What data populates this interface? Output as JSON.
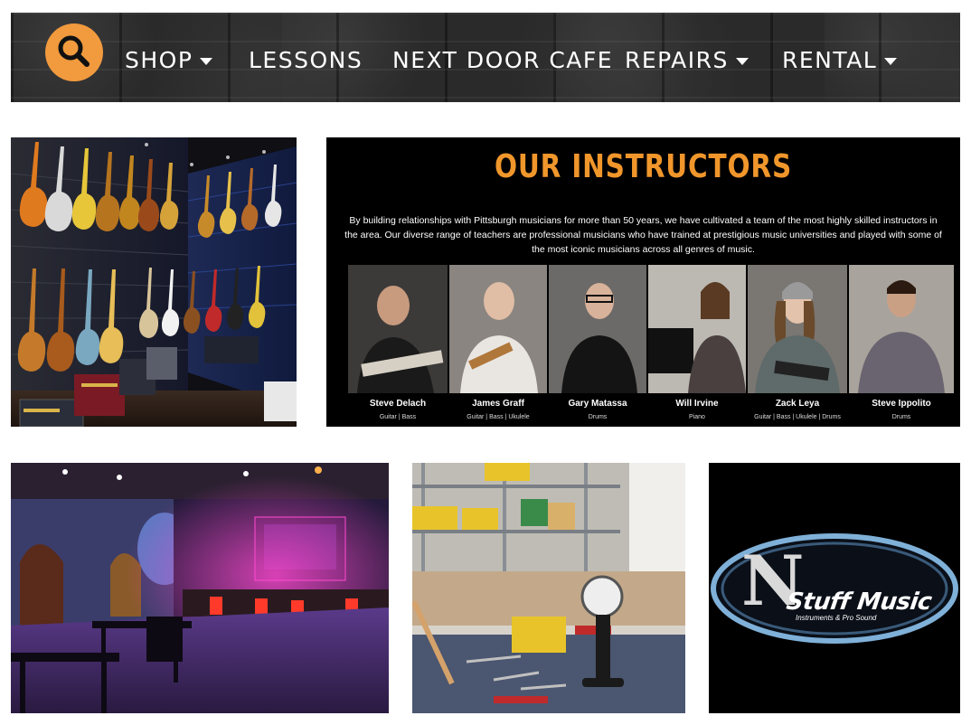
{
  "nav": {
    "items": [
      {
        "label": "SHOP",
        "has_dropdown": true
      },
      {
        "label": "LESSONS",
        "has_dropdown": false
      },
      {
        "label": "NEXT DOOR CAFE",
        "has_dropdown": false
      },
      {
        "label": "REPAIRS",
        "has_dropdown": true
      },
      {
        "label": "RENTAL",
        "has_dropdown": true
      }
    ],
    "search_icon": "search-icon",
    "accent_color": "#f19a3e"
  },
  "instructors": {
    "title": "OUR INSTRUCTORS",
    "body": "By building relationships with Pittsburgh musicians for more than 50 years, we have cultivated a team of the most highly skilled instructors in the area. Our diverse range of teachers are professional musicians who have trained at prestigious music universities and played with some of the most iconic musicians across all genres of music.",
    "people": [
      {
        "name": "Steve Delach",
        "instruments": "Guitar | Bass"
      },
      {
        "name": "James Graff",
        "instruments": "Guitar | Bass | Ukulele"
      },
      {
        "name": "Gary Matassa",
        "instruments": "Drums"
      },
      {
        "name": "Will Irvine",
        "instruments": "Piano"
      },
      {
        "name": "Zack Leya",
        "instruments": "Guitar | Bass | Ukulele | Drums"
      },
      {
        "name": "Steve Ippolito",
        "instruments": "Drums"
      }
    ],
    "title_color": "#f0962b"
  },
  "logo": {
    "letter": "N",
    "text": "Stuff Music",
    "tagline": "Instruments & Pro Sound"
  }
}
